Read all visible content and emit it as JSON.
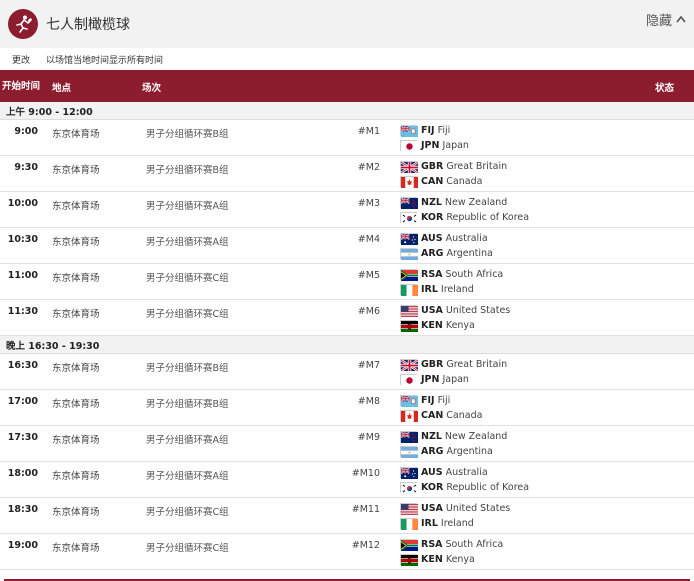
{
  "header": {
    "title": "七人制橄榄球",
    "hide_label": "隐藏"
  },
  "timezone": {
    "change_label": "更改",
    "note": "以场馆当地时间显示所有时间"
  },
  "columns": {
    "time": "开始时间",
    "venue": "地点",
    "event": "场次",
    "status": "状态"
  },
  "sessions": [
    {
      "label": "上午  9:00 - 12:00",
      "matches": [
        {
          "time": "9:00",
          "venue": "东京体育场",
          "event": "男子分组循环赛B组",
          "num": "#M1",
          "team1": {
            "code": "FIJ",
            "name": "Fiji"
          },
          "team2": {
            "code": "JPN",
            "name": "Japan"
          }
        },
        {
          "time": "9:30",
          "venue": "东京体育场",
          "event": "男子分组循环赛B组",
          "num": "#M2",
          "team1": {
            "code": "GBR",
            "name": "Great Britain"
          },
          "team2": {
            "code": "CAN",
            "name": "Canada"
          }
        },
        {
          "time": "10:00",
          "venue": "东京体育场",
          "event": "男子分组循环赛A组",
          "num": "#M3",
          "team1": {
            "code": "NZL",
            "name": "New Zealand"
          },
          "team2": {
            "code": "KOR",
            "name": "Republic of Korea"
          }
        },
        {
          "time": "10:30",
          "venue": "东京体育场",
          "event": "男子分组循环赛A组",
          "num": "#M4",
          "team1": {
            "code": "AUS",
            "name": "Australia"
          },
          "team2": {
            "code": "ARG",
            "name": "Argentina"
          }
        },
        {
          "time": "11:00",
          "venue": "东京体育场",
          "event": "男子分组循环赛C组",
          "num": "#M5",
          "team1": {
            "code": "RSA",
            "name": "South Africa"
          },
          "team2": {
            "code": "IRL",
            "name": "Ireland"
          }
        },
        {
          "time": "11:30",
          "venue": "东京体育场",
          "event": "男子分组循环赛C组",
          "num": "#M6",
          "team1": {
            "code": "USA",
            "name": "United States"
          },
          "team2": {
            "code": "KEN",
            "name": "Kenya"
          }
        }
      ]
    },
    {
      "label": "晚上  16:30 - 19:30",
      "matches": [
        {
          "time": "16:30",
          "venue": "东京体育场",
          "event": "男子分组循环赛B组",
          "num": "#M7",
          "team1": {
            "code": "GBR",
            "name": "Great Britain"
          },
          "team2": {
            "code": "JPN",
            "name": "Japan"
          }
        },
        {
          "time": "17:00",
          "venue": "东京体育场",
          "event": "男子分组循环赛B组",
          "num": "#M8",
          "team1": {
            "code": "FIJ",
            "name": "Fiji"
          },
          "team2": {
            "code": "CAN",
            "name": "Canada"
          }
        },
        {
          "time": "17:30",
          "venue": "东京体育场",
          "event": "男子分组循环赛A组",
          "num": "#M9",
          "team1": {
            "code": "NZL",
            "name": "New Zealand"
          },
          "team2": {
            "code": "ARG",
            "name": "Argentina"
          }
        },
        {
          "time": "18:00",
          "venue": "东京体育场",
          "event": "男子分组循环赛A组",
          "num": "#M10",
          "team1": {
            "code": "AUS",
            "name": "Australia"
          },
          "team2": {
            "code": "KOR",
            "name": "Republic of Korea"
          }
        },
        {
          "time": "18:30",
          "venue": "东京体育场",
          "event": "男子分组循环赛C组",
          "num": "#M11",
          "team1": {
            "code": "USA",
            "name": "United States"
          },
          "team2": {
            "code": "IRL",
            "name": "Ireland"
          }
        },
        {
          "time": "19:00",
          "venue": "东京体育场",
          "event": "男子分组循环赛C组",
          "num": "#M12",
          "team1": {
            "code": "RSA",
            "name": "South Africa"
          },
          "team2": {
            "code": "KEN",
            "name": "Kenya"
          }
        }
      ]
    }
  ],
  "icons": {
    "logo": "rugby-sevens-pictogram-icon",
    "hide": "chevron-up-icon"
  },
  "colors": {
    "accent": "#8c1d2e",
    "session_bg": "#f2f2f2",
    "header_bg": "#f2f2f2"
  }
}
